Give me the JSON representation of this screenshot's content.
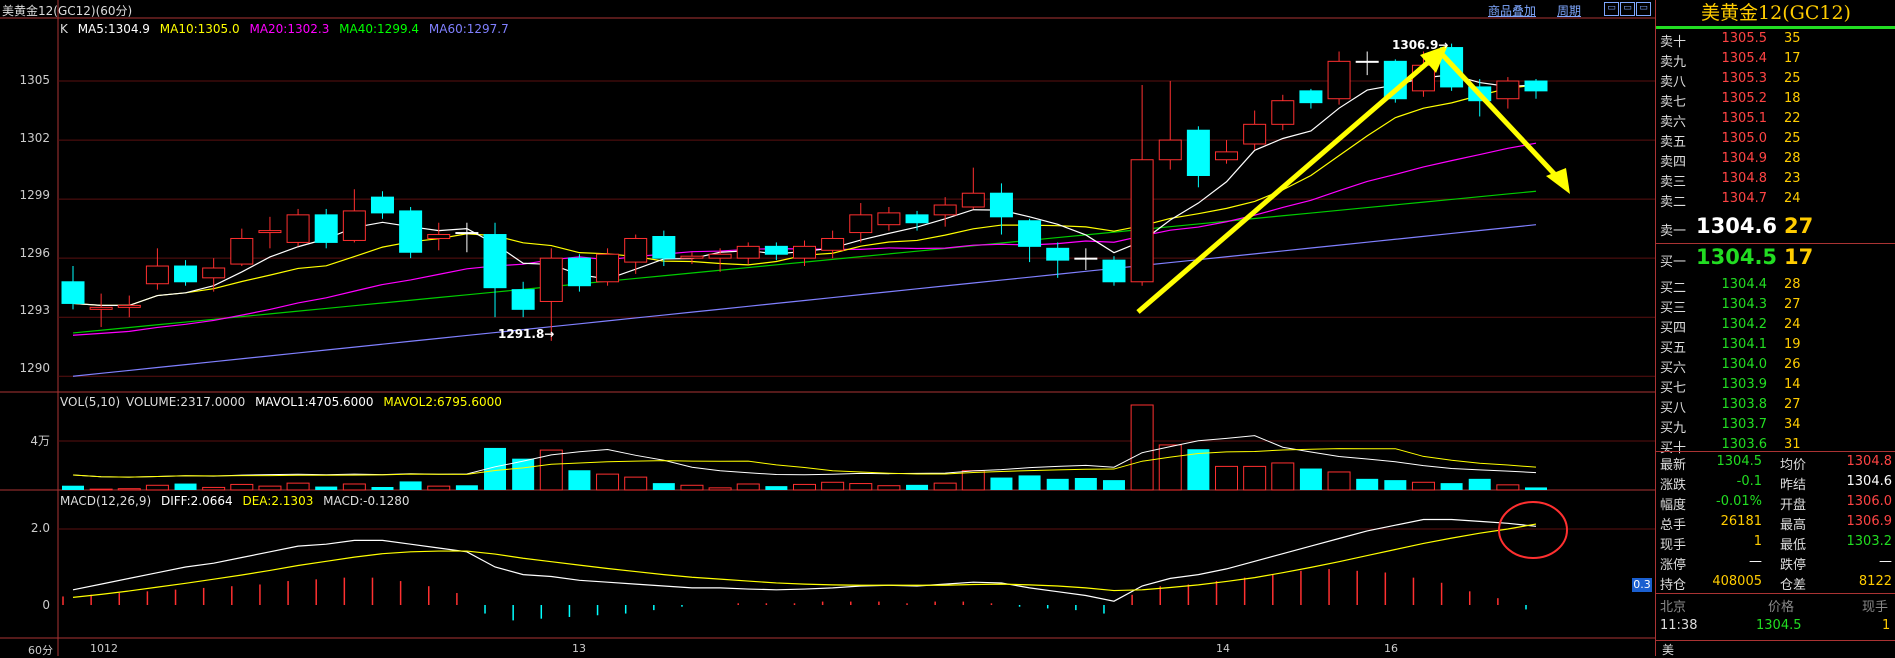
{
  "header": {
    "symbol_title": "美黄金12(GC12)(60分)",
    "overlay_link": "商品叠加",
    "period_link": "周期"
  },
  "main_panel": {
    "k_label": "K",
    "ma": [
      {
        "label": "MA5:1304.9",
        "color": "#ffffff"
      },
      {
        "label": "MA10:1305.0",
        "color": "#ffff00"
      },
      {
        "label": "MA20:1302.3",
        "color": "#ff00ff"
      },
      {
        "label": "MA40:1299.4",
        "color": "#00ff00"
      },
      {
        "label": "MA60:1297.7",
        "color": "#8080ff"
      }
    ],
    "y_ticks": [
      "1305",
      "1302",
      "1299",
      "1296",
      "1293",
      "1290"
    ],
    "high_marker": "1306.9→",
    "low_marker": "1291.8→"
  },
  "volume_panel": {
    "title_vol": "VOL(5,10)",
    "volume": "VOLUME:2317.0000",
    "mavol1": "MAVOL1:4705.6000",
    "mavol2": "MAVOL2:6795.6000",
    "y_tick": "4万"
  },
  "macd_panel": {
    "title": "MACD(12,26,9)",
    "diff": "DIFF:2.0664",
    "dea": "DEA:2.1303",
    "macd": "MACD:-0.1280",
    "y_ticks": [
      "2.0",
      "0"
    ],
    "tag": "0.3"
  },
  "x_axis": {
    "period": "60分",
    "labels": [
      "1012",
      "13",
      "14",
      "16"
    ]
  },
  "quote_panel": {
    "title": "美黄金12(GC12)",
    "asks": [
      {
        "label": "卖十",
        "price": "1305.5",
        "vol": "35"
      },
      {
        "label": "卖九",
        "price": "1305.4",
        "vol": "17"
      },
      {
        "label": "卖八",
        "price": "1305.3",
        "vol": "25"
      },
      {
        "label": "卖七",
        "price": "1305.2",
        "vol": "18"
      },
      {
        "label": "卖六",
        "price": "1305.1",
        "vol": "22"
      },
      {
        "label": "卖五",
        "price": "1305.0",
        "vol": "25"
      },
      {
        "label": "卖四",
        "price": "1304.9",
        "vol": "28"
      },
      {
        "label": "卖三",
        "price": "1304.8",
        "vol": "23"
      },
      {
        "label": "卖二",
        "price": "1304.7",
        "vol": "24"
      }
    ],
    "ask1": {
      "label": "卖一",
      "price": "1304.6",
      "vol": "27"
    },
    "bid1": {
      "label": "买一",
      "price": "1304.5",
      "vol": "17"
    },
    "bids": [
      {
        "label": "买二",
        "price": "1304.4",
        "vol": "28"
      },
      {
        "label": "买三",
        "price": "1304.3",
        "vol": "27"
      },
      {
        "label": "买四",
        "price": "1304.2",
        "vol": "24"
      },
      {
        "label": "买五",
        "price": "1304.1",
        "vol": "19"
      },
      {
        "label": "买六",
        "price": "1304.0",
        "vol": "26"
      },
      {
        "label": "买七",
        "price": "1303.9",
        "vol": "14"
      },
      {
        "label": "买八",
        "price": "1303.8",
        "vol": "27"
      },
      {
        "label": "买九",
        "price": "1303.7",
        "vol": "34"
      },
      {
        "label": "买十",
        "price": "1303.6",
        "vol": "31"
      }
    ],
    "stats": [
      {
        "l1": "最新",
        "v1": "1304.5",
        "c1": "green",
        "l2": "均价",
        "v2": "1304.8",
        "c2": "red"
      },
      {
        "l1": "涨跌",
        "v1": "-0.1",
        "c1": "green",
        "l2": "昨结",
        "v2": "1304.6",
        "c2": "white"
      },
      {
        "l1": "幅度",
        "v1": "-0.01%",
        "c1": "green",
        "l2": "开盘",
        "v2": "1306.0",
        "c2": "red"
      },
      {
        "l1": "总手",
        "v1": "26181",
        "c1": "yellow",
        "l2": "最高",
        "v2": "1306.9",
        "c2": "red"
      },
      {
        "l1": "现手",
        "v1": "1",
        "c1": "yellow",
        "l2": "最低",
        "v2": "1303.2",
        "c2": "green"
      },
      {
        "l1": "涨停",
        "v1": "—",
        "c1": "white",
        "l2": "跌停",
        "v2": "—",
        "c2": "white"
      },
      {
        "l1": "持仓",
        "v1": "408005",
        "c1": "yellow",
        "l2": "仓差",
        "v2": "8122",
        "c2": "yellow"
      }
    ],
    "tick_header": {
      "col1": "北京",
      "col2": "价格",
      "col3": "现手"
    },
    "tick_row": {
      "time": "11:38",
      "price": "1304.5",
      "vol": "1"
    },
    "footer_char": "美"
  },
  "chart_data": {
    "type": "candlestick",
    "ylim": [
      1289.5,
      1308.0
    ],
    "candles": [
      [
        1294.8,
        1293.7,
        1295.6,
        1293.4
      ],
      [
        1293.4,
        1293.5,
        1294.2,
        1292.5
      ],
      [
        1293.5,
        1293.6,
        1294.1,
        1293.0
      ],
      [
        1294.7,
        1295.6,
        1296.5,
        1294.4
      ],
      [
        1295.6,
        1294.8,
        1295.9,
        1294.6
      ],
      [
        1295.0,
        1295.5,
        1296.0,
        1294.3
      ],
      [
        1295.7,
        1297.0,
        1297.5,
        1295.6
      ],
      [
        1297.3,
        1297.4,
        1298.1,
        1296.5
      ],
      [
        1296.8,
        1298.2,
        1298.5,
        1296.6
      ],
      [
        1298.2,
        1296.8,
        1298.5,
        1296.5
      ],
      [
        1296.9,
        1298.4,
        1299.5,
        1296.8
      ],
      [
        1299.1,
        1298.3,
        1299.4,
        1298.0
      ],
      [
        1298.4,
        1296.3,
        1298.6,
        1296.0
      ],
      [
        1297.0,
        1297.2,
        1297.8,
        1296.4
      ],
      [
        1297.3,
        1297.3,
        1297.8,
        1296.3
      ],
      [
        1297.2,
        1294.5,
        1297.8,
        1293.0
      ],
      [
        1294.4,
        1293.4,
        1294.8,
        1293.0
      ],
      [
        1293.8,
        1296.0,
        1296.5,
        1291.8
      ],
      [
        1296.0,
        1294.6,
        1296.2,
        1294.3
      ],
      [
        1294.8,
        1296.2,
        1296.5,
        1294.6
      ],
      [
        1295.8,
        1297.0,
        1297.2,
        1295.2
      ],
      [
        1297.1,
        1296.0,
        1297.4,
        1295.6
      ],
      [
        1296.0,
        1296.1,
        1296.3,
        1295.7
      ],
      [
        1296.0,
        1296.2,
        1296.5,
        1295.3
      ],
      [
        1296.0,
        1296.6,
        1296.8,
        1295.7
      ],
      [
        1296.6,
        1296.2,
        1296.8,
        1295.9
      ],
      [
        1296.0,
        1296.6,
        1296.9,
        1295.6
      ],
      [
        1296.4,
        1297.0,
        1297.4,
        1296.0
      ],
      [
        1297.3,
        1298.2,
        1298.8,
        1296.8
      ],
      [
        1297.7,
        1298.3,
        1298.6,
        1297.4
      ],
      [
        1298.2,
        1297.8,
        1298.4,
        1297.4
      ],
      [
        1298.2,
        1298.7,
        1299.1,
        1297.6
      ],
      [
        1298.6,
        1299.3,
        1300.6,
        1298.5
      ],
      [
        1299.3,
        1298.1,
        1299.8,
        1297.2
      ],
      [
        1297.9,
        1296.6,
        1298.0,
        1295.8
      ],
      [
        1296.5,
        1295.9,
        1296.8,
        1295.0
      ],
      [
        1296.0,
        1296.0,
        1296.5,
        1295.4
      ],
      [
        1295.9,
        1294.8,
        1296.1,
        1294.6
      ],
      [
        1294.8,
        1301.0,
        1304.8,
        1294.6
      ],
      [
        1301.0,
        1302.0,
        1305.0,
        1300.5
      ],
      [
        1302.5,
        1300.2,
        1302.7,
        1299.6
      ],
      [
        1301.0,
        1301.4,
        1302.0,
        1300.8
      ],
      [
        1301.8,
        1302.8,
        1303.5,
        1301.5
      ],
      [
        1302.8,
        1304.0,
        1304.3,
        1302.5
      ],
      [
        1304.5,
        1303.9,
        1304.6,
        1303.6
      ],
      [
        1304.1,
        1306.0,
        1306.5,
        1303.8
      ],
      [
        1306.0,
        1306.0,
        1306.5,
        1305.3
      ],
      [
        1306.0,
        1304.1,
        1306.1,
        1303.9
      ],
      [
        1304.5,
        1305.8,
        1306.5,
        1304.2
      ],
      [
        1306.7,
        1304.7,
        1306.9,
        1304.5
      ],
      [
        1304.7,
        1304.0,
        1305.1,
        1303.2
      ],
      [
        1304.1,
        1305.0,
        1305.2,
        1303.6
      ],
      [
        1305.0,
        1304.5,
        1305.1,
        1304.1
      ]
    ],
    "volume": [
      1,
      0.2,
      0.3,
      1.1,
      1.5,
      0.6,
      1.3,
      0.9,
      1.6,
      0.8,
      1.4,
      0.7,
      2.0,
      0.9,
      1.1,
      9.8,
      7.3,
      9.3,
      4.6,
      3.7,
      3.0,
      1.6,
      1.1,
      0.5,
      1.4,
      0.9,
      1.3,
      1.8,
      1.5,
      1.0,
      1.2,
      1.6,
      4.5,
      2.9,
      3.4,
      2.6,
      2.8,
      2.3,
      19.8,
      10.5,
      9.5,
      5.5,
      5.5,
      6.3,
      5.0,
      4.2,
      2.6,
      2.3,
      1.8,
      1.6,
      2.6,
      1.2,
      0.6
    ],
    "macd_hist": [
      0.25,
      0.3,
      0.35,
      0.4,
      0.45,
      0.5,
      0.55,
      0.6,
      0.7,
      0.75,
      0.8,
      0.8,
      0.7,
      0.55,
      0.35,
      -0.25,
      -0.45,
      -0.4,
      -0.35,
      -0.3,
      -0.25,
      -0.15,
      -0.05,
      0.0,
      0.05,
      0.05,
      0.05,
      0.1,
      0.1,
      0.1,
      0.05,
      0.1,
      0.1,
      0.05,
      -0.05,
      -0.1,
      -0.15,
      -0.25,
      0.3,
      0.55,
      0.6,
      0.7,
      0.8,
      0.9,
      1.0,
      1.05,
      1.0,
      0.95,
      0.8,
      0.65,
      0.4,
      0.2,
      -0.13
    ],
    "y_ticks_macd": [
      2.0,
      0
    ]
  }
}
